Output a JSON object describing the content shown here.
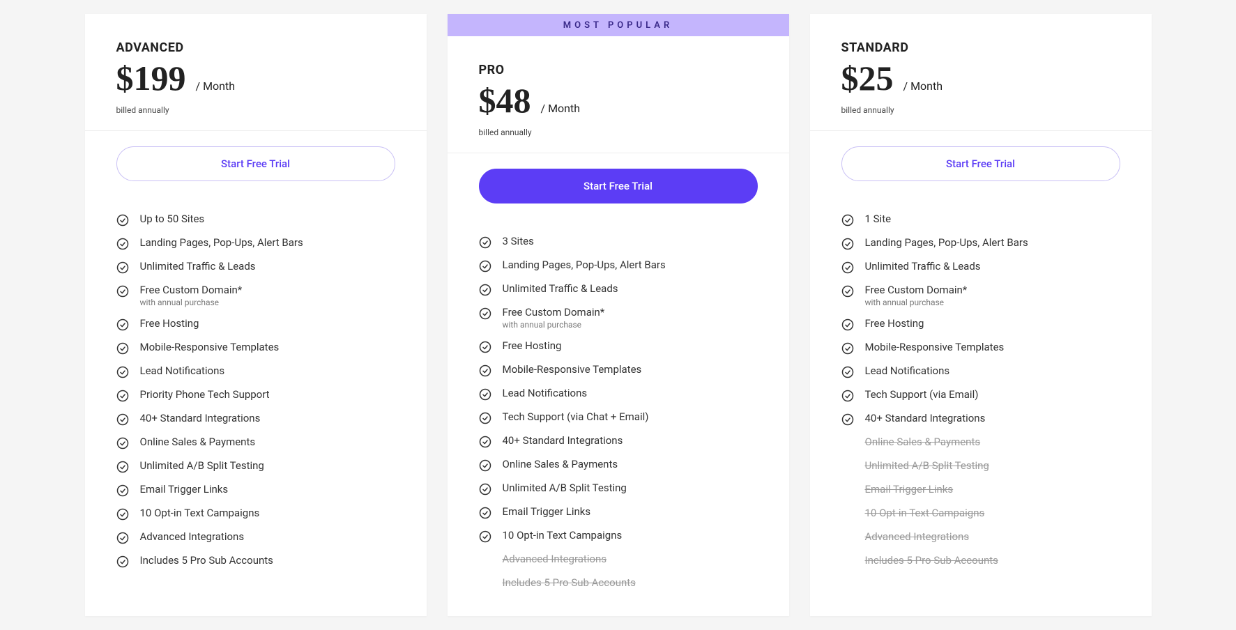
{
  "common": {
    "per_month": "/ Month",
    "billed_annually": "billed annually",
    "cta_label": "Start Free Trial"
  },
  "most_popular_label": "MOST POPULAR",
  "plans": [
    {
      "id": "advanced",
      "name": "ADVANCED",
      "price": "$199",
      "highlight": false,
      "cta_variant": "outline",
      "features": [
        {
          "text": "Up to 50 Sites",
          "included": true
        },
        {
          "text": "Landing Pages, Pop-Ups, Alert Bars",
          "included": true
        },
        {
          "text": "Unlimited Traffic & Leads",
          "included": true
        },
        {
          "text": "Free Custom Domain*",
          "subtext": "with annual purchase",
          "included": true
        },
        {
          "text": "Free Hosting",
          "included": true
        },
        {
          "text": "Mobile-Responsive Templates",
          "included": true
        },
        {
          "text": "Lead Notifications",
          "included": true
        },
        {
          "text": "Priority Phone Tech Support",
          "included": true
        },
        {
          "text": "40+ Standard Integrations",
          "included": true
        },
        {
          "text": "Online Sales & Payments",
          "included": true
        },
        {
          "text": "Unlimited A/B Split Testing",
          "included": true
        },
        {
          "text": "Email Trigger Links",
          "included": true
        },
        {
          "text": "10 Opt-in Text Campaigns",
          "included": true
        },
        {
          "text": "Advanced Integrations",
          "included": true
        },
        {
          "text": "Includes 5 Pro Sub Accounts",
          "included": true
        }
      ]
    },
    {
      "id": "pro",
      "name": "PRO",
      "price": "$48",
      "highlight": true,
      "cta_variant": "primary",
      "features": [
        {
          "text": "3 Sites",
          "included": true
        },
        {
          "text": "Landing Pages, Pop-Ups, Alert Bars",
          "included": true
        },
        {
          "text": "Unlimited Traffic & Leads",
          "included": true
        },
        {
          "text": "Free Custom Domain*",
          "subtext": "with annual purchase",
          "included": true
        },
        {
          "text": "Free Hosting",
          "included": true
        },
        {
          "text": "Mobile-Responsive Templates",
          "included": true
        },
        {
          "text": "Lead Notifications",
          "included": true
        },
        {
          "text": "Tech Support (via Chat + Email)",
          "included": true
        },
        {
          "text": "40+ Standard Integrations",
          "included": true
        },
        {
          "text": "Online Sales & Payments",
          "included": true
        },
        {
          "text": "Unlimited A/B Split Testing",
          "included": true
        },
        {
          "text": "Email Trigger Links",
          "included": true
        },
        {
          "text": "10 Opt-in Text Campaigns",
          "included": true
        },
        {
          "text": "Advanced Integrations",
          "included": false
        },
        {
          "text": "Includes 5 Pro Sub Accounts",
          "included": false
        }
      ]
    },
    {
      "id": "standard",
      "name": "STANDARD",
      "price": "$25",
      "highlight": false,
      "cta_variant": "outline",
      "features": [
        {
          "text": "1 Site",
          "included": true
        },
        {
          "text": "Landing Pages, Pop-Ups, Alert Bars",
          "included": true
        },
        {
          "text": "Unlimited Traffic & Leads",
          "included": true
        },
        {
          "text": "Free Custom Domain*",
          "subtext": "with annual purchase",
          "included": true
        },
        {
          "text": "Free Hosting",
          "included": true
        },
        {
          "text": "Mobile-Responsive Templates",
          "included": true
        },
        {
          "text": "Lead Notifications",
          "included": true
        },
        {
          "text": "Tech Support (via Email)",
          "included": true
        },
        {
          "text": "40+ Standard Integrations",
          "included": true
        },
        {
          "text": "Online Sales & Payments",
          "included": false
        },
        {
          "text": "Unlimited A/B Split Testing",
          "included": false
        },
        {
          "text": "Email Trigger Links",
          "included": false
        },
        {
          "text": "10 Opt-in Text Campaigns",
          "included": false
        },
        {
          "text": "Advanced Integrations",
          "included": false
        },
        {
          "text": "Includes 5 Pro Sub Accounts",
          "included": false
        }
      ]
    }
  ]
}
